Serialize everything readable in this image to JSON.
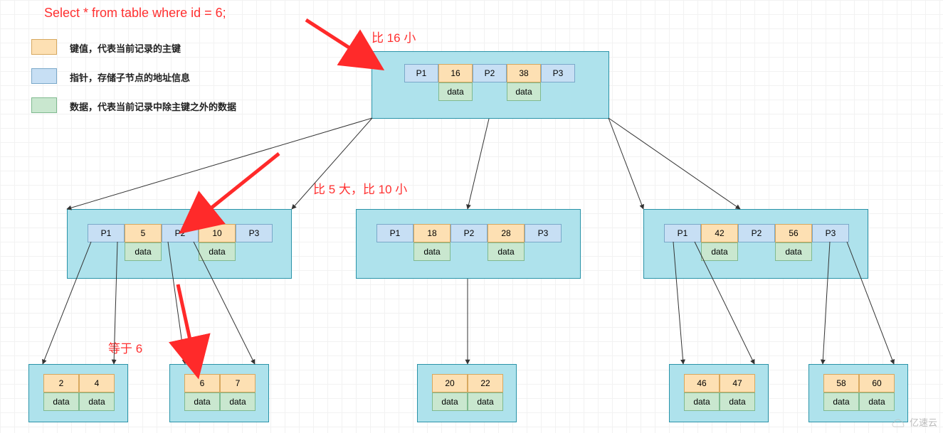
{
  "sql_title": "Select * from table where id = 6;",
  "legend": {
    "key": "键值，代表当前记录的主键",
    "ptr": "指针，存储子节点的地址信息",
    "data": "数据，代表当前记录中除主键之外的数据"
  },
  "annotations": {
    "top": "比 16 小",
    "mid": "比 5 大，比 10 小",
    "bottom": "等于 6"
  },
  "root": {
    "p1": "P1",
    "k1": "16",
    "p2": "P2",
    "k2": "38",
    "p3": "P3",
    "data": "data"
  },
  "mid": [
    {
      "p1": "P1",
      "k1": "5",
      "p2": "P2",
      "k2": "10",
      "p3": "P3",
      "data": "data"
    },
    {
      "p1": "P1",
      "k1": "18",
      "p2": "P2",
      "k2": "28",
      "p3": "P3",
      "data": "data"
    },
    {
      "p1": "P1",
      "k1": "42",
      "p2": "P2",
      "k2": "56",
      "p3": "P3",
      "data": "data"
    }
  ],
  "leaf": [
    {
      "k1": "2",
      "k2": "4",
      "data": "data"
    },
    {
      "k1": "6",
      "k2": "7",
      "data": "data"
    },
    {
      "k1": "20",
      "k2": "22",
      "data": "data"
    },
    {
      "k1": "46",
      "k2": "47",
      "data": "data"
    },
    {
      "k1": "58",
      "k2": "60",
      "data": "data"
    }
  ],
  "watermark": "亿速云",
  "chart_data": {
    "type": "tree",
    "description": "B+ tree index lookup for id=6",
    "root_keys": [
      16,
      38
    ],
    "level1_keys": [
      [
        5,
        10
      ],
      [
        18,
        28
      ],
      [
        42,
        56
      ]
    ],
    "leaf_keys": [
      [
        2,
        4
      ],
      [
        6,
        7
      ],
      [
        20,
        22
      ],
      [
        46,
        47
      ],
      [
        58,
        60
      ]
    ],
    "search_path_labels": [
      "比 16 小",
      "比 5 大，比 10 小",
      "等于 6"
    ],
    "target_id": 6
  }
}
